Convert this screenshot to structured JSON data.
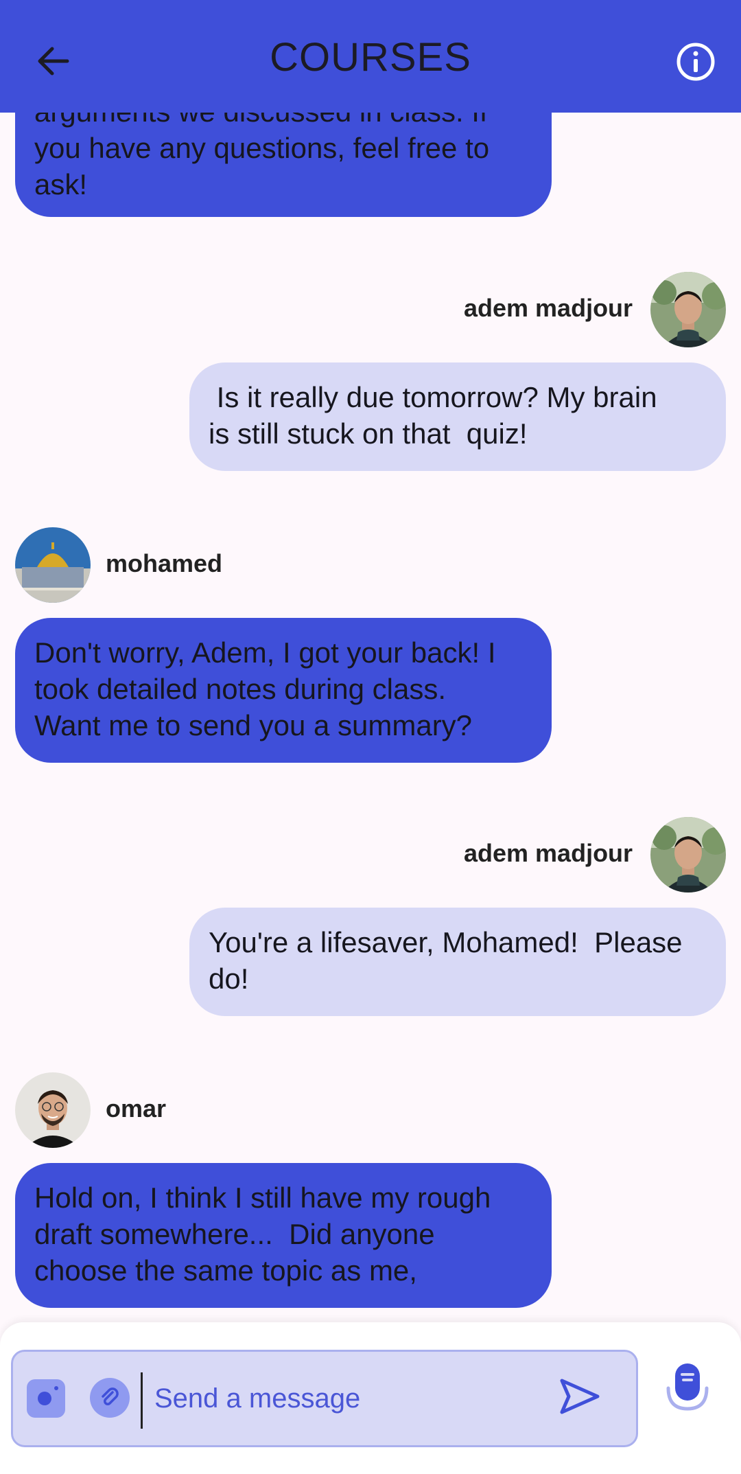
{
  "header": {
    "title": "COURSES",
    "back_icon": "arrow-left-icon",
    "info_icon": "info-icon"
  },
  "colors": {
    "accent": "#3f4fd9",
    "outgoing_bubble": "#d8d9f6",
    "background": "#fef8fc"
  },
  "messages": [
    {
      "sender": "",
      "direction": "incoming",
      "lines": [
        "arguments we discussed in class. If",
        "you have any questions, feel free to",
        "ask!"
      ]
    },
    {
      "sender": "adem madjour",
      "direction": "outgoing",
      "lines": [
        " Is it really due tomorrow? My brain",
        "is still stuck on that  quiz!"
      ]
    },
    {
      "sender": "mohamed",
      "direction": "incoming",
      "lines": [
        "Don't worry, Adem, I got your back! I",
        "took detailed notes during class.",
        "Want me to send you a summary?"
      ]
    },
    {
      "sender": "adem madjour",
      "direction": "outgoing",
      "lines": [
        "You're a lifesaver, Mohamed!  Please",
        "do!"
      ]
    },
    {
      "sender": "omar",
      "direction": "incoming",
      "lines": [
        "Hold on, I think I still have my rough",
        "draft somewhere...  Did anyone",
        "choose the same topic as me,"
      ]
    }
  ],
  "composer": {
    "placeholder": "Send a message",
    "camera_icon": "camera-icon",
    "attach_icon": "attachment-icon",
    "send_icon": "send-icon",
    "mic_icon": "microphone-icon"
  }
}
